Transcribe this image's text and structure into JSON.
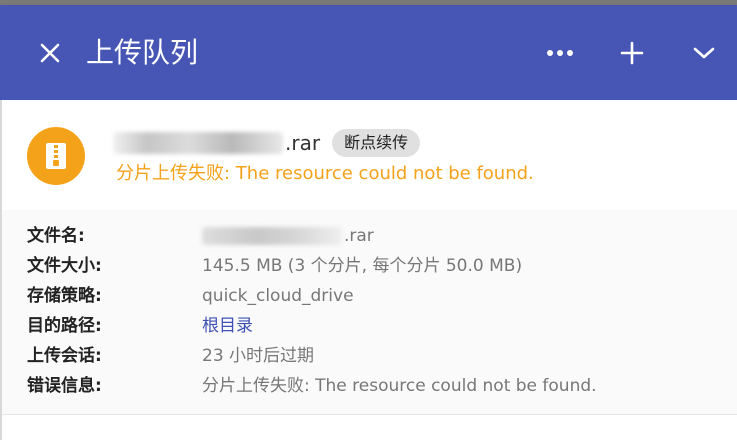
{
  "header": {
    "title": "上传队列",
    "bg_color": "#4756b4"
  },
  "icons": {
    "close": "close-icon",
    "more": "more-horizontal-icon",
    "add": "plus-icon",
    "collapse": "chevron-down-icon",
    "file": "zip-archive-icon"
  },
  "task": {
    "file_name_visible": ".rar",
    "resume_chip": "断点续传",
    "error_line": "分片上传失败: The resource could not be found.",
    "accent_color": "#f5a21b"
  },
  "details": {
    "rows": [
      {
        "label": "文件名:",
        "value": ".rar"
      },
      {
        "label": "文件大小:",
        "value": "145.5 MB (3 个分片, 每个分片 50.0 MB)"
      },
      {
        "label": "存储策略:",
        "value": "quick_cloud_drive"
      },
      {
        "label": "目的路径:",
        "value": "根目录"
      },
      {
        "label": "上传会话:",
        "value": "23 小时后过期"
      },
      {
        "label": "错误信息:",
        "value": "分片上传失败: The resource could not be found."
      }
    ]
  }
}
